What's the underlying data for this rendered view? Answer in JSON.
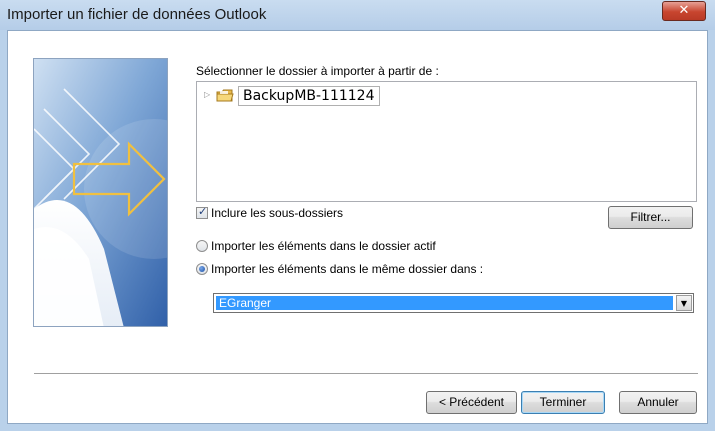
{
  "window": {
    "title": "Importer un fichier de données Outlook",
    "close_glyph": "✕"
  },
  "prompt_label": "Sélectionner le dossier à importer à partir de :",
  "tree": {
    "items": [
      {
        "label": "BackupMB-111124",
        "expanded": false
      }
    ]
  },
  "include_subfolders": {
    "label": "Inclure les sous-dossiers",
    "checked": true
  },
  "filter_button": "Filtrer...",
  "import_options": [
    {
      "label": "Importer les éléments dans le dossier actif",
      "selected": false
    },
    {
      "label": "Importer les éléments dans le même dossier dans :",
      "selected": true
    }
  ],
  "target_folder": {
    "value": "EGranger"
  },
  "buttons": {
    "back": "< Précédent",
    "finish": "Terminer",
    "cancel": "Annuler"
  },
  "colors": {
    "selection": "#3399ff",
    "title_bar": "#b9d1ea",
    "close_button": "#c8452f"
  },
  "icons": {
    "banner": "wizard-arrows-graphic",
    "folder": "pst-folder-icon",
    "expander": "triangle-right-icon"
  }
}
